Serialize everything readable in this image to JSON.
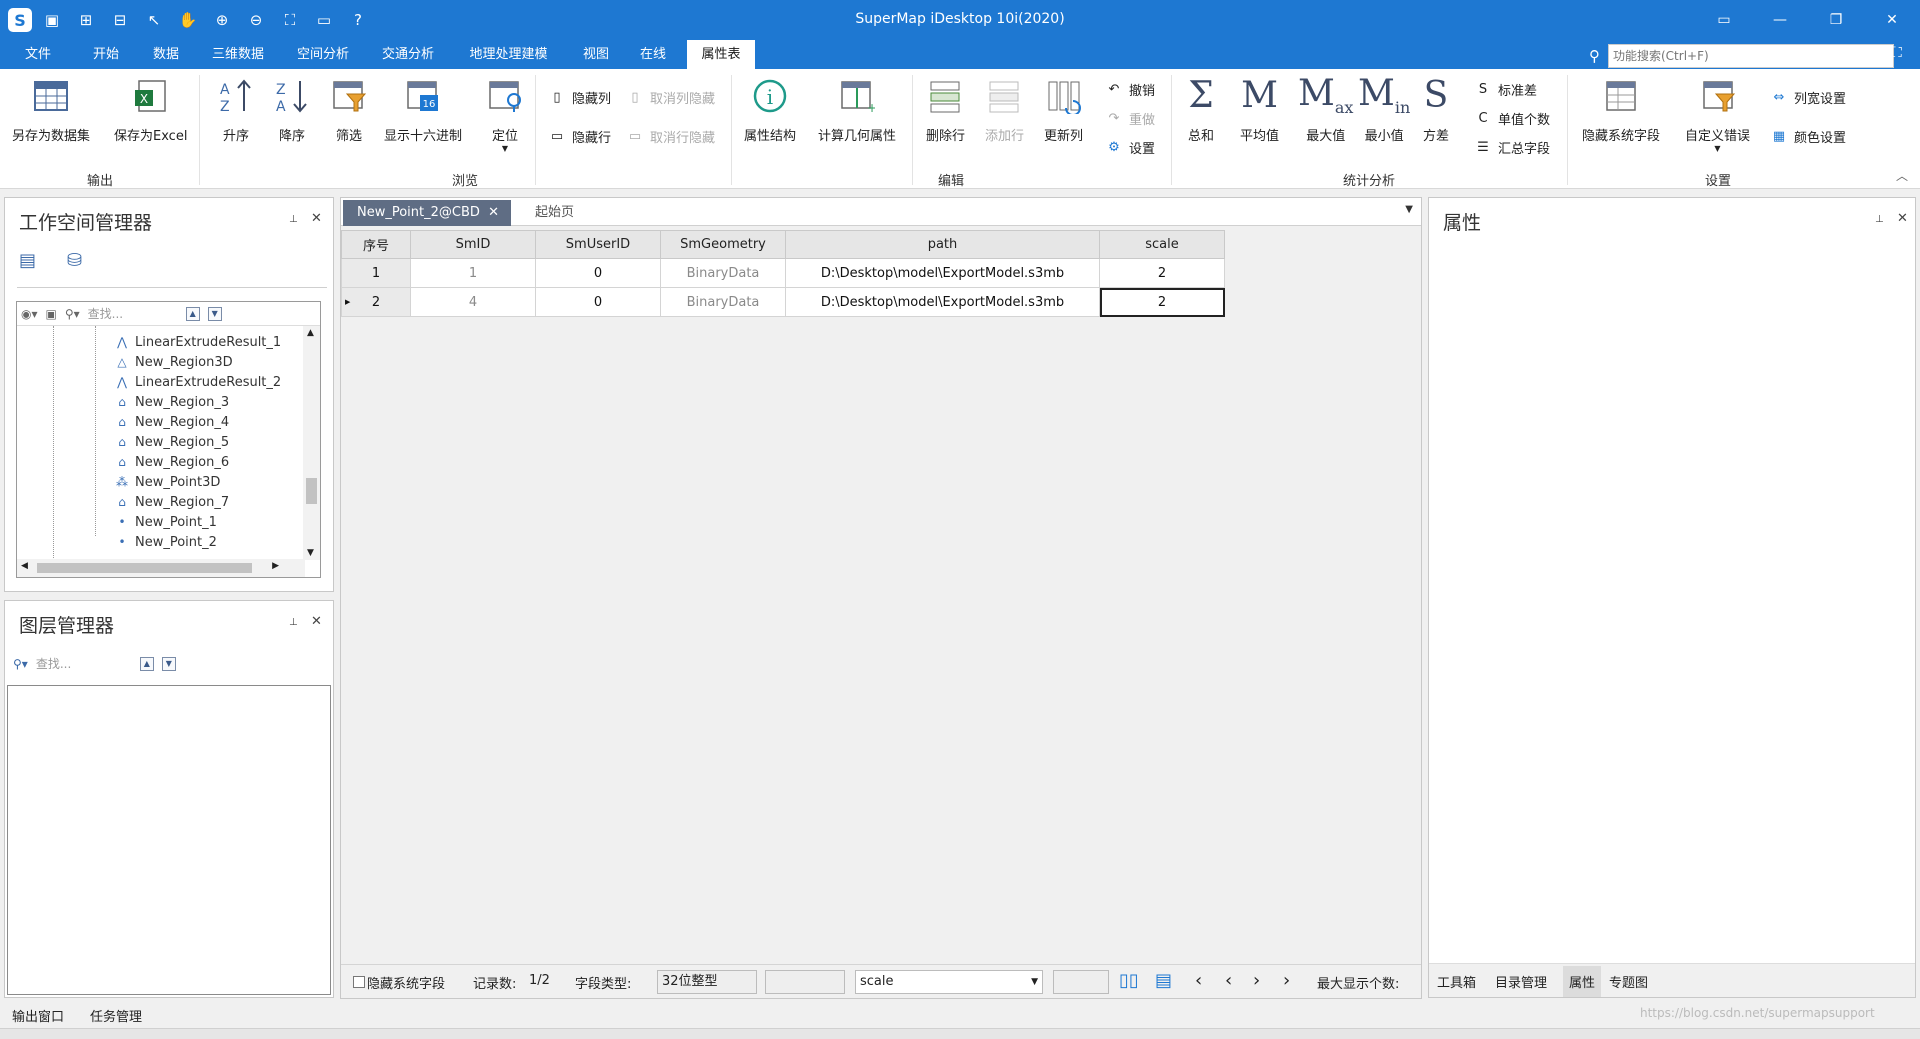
{
  "app": {
    "title": "SuperMap iDesktop 10i(2020)"
  },
  "menu": [
    "文件",
    "开始",
    "数据",
    "三维数据",
    "空间分析",
    "交通分析",
    "地理处理建模",
    "视图",
    "在线",
    "属性表"
  ],
  "active_menu": "属性表",
  "search": {
    "placeholder": "功能搜索(Ctrl+F)"
  },
  "ribbon": {
    "output": {
      "group": "输出",
      "save_dataset": "另存为数据集",
      "save_excel": "保存为Excel"
    },
    "browse": {
      "group": "浏览",
      "asc": "升序",
      "desc": "降序",
      "filter": "筛选",
      "hex": "显示十六进制",
      "locate": "定位",
      "hide_col": "隐藏列",
      "hide_row": "隐藏行",
      "unhide_col": "取消列隐藏",
      "unhide_row": "取消行隐藏"
    },
    "edit": {
      "group": "编辑",
      "attr_struct": "属性结构",
      "calc_geom": "计算几何属性",
      "del_row": "删除行",
      "add_row": "添加行",
      "update_col": "更新列",
      "undo": "撤销",
      "redo": "重做",
      "settings": "设置"
    },
    "stats": {
      "group": "统计分析",
      "sum": "总和",
      "avg": "平均值",
      "max": "最大值",
      "min": "最小值",
      "var": "方差",
      "std": "标准差",
      "unique": "单值个数",
      "summary": "汇总字段"
    },
    "config": {
      "group": "设置",
      "hide_sys": "隐藏系统字段",
      "custom_err": "自定义错误",
      "col_width": "列宽设置",
      "color": "颜色设置"
    }
  },
  "workspace": {
    "title": "工作空间管理器",
    "search_placeholder": "查找...",
    "items": [
      {
        "label": "LinearExtrudeResult_1",
        "icon": "line-dataset-icon"
      },
      {
        "label": "New_Region3D",
        "icon": "region3d-icon"
      },
      {
        "label": "LinearExtrudeResult_2",
        "icon": "line-dataset-icon"
      },
      {
        "label": "New_Region_3",
        "icon": "region-icon"
      },
      {
        "label": "New_Region_4",
        "icon": "region-icon"
      },
      {
        "label": "New_Region_5",
        "icon": "region-icon"
      },
      {
        "label": "New_Region_6",
        "icon": "region-icon"
      },
      {
        "label": "New_Point3D",
        "icon": "point3d-icon"
      },
      {
        "label": "New_Region_7",
        "icon": "region-icon"
      },
      {
        "label": "New_Point_1",
        "icon": "point-icon"
      },
      {
        "label": "New_Point_2",
        "icon": "point-icon"
      }
    ]
  },
  "layers": {
    "title": "图层管理器",
    "search_placeholder": "查找..."
  },
  "properties": {
    "title": "属性",
    "tabs": [
      "工具箱",
      "目录管理",
      "属性",
      "专题图"
    ],
    "active_tab": "属性"
  },
  "document": {
    "tabs": [
      "New_Point_2@CBD",
      "起始页"
    ],
    "columns": [
      "序号",
      "SmID",
      "SmUserID",
      "SmGeometry",
      "path",
      "scale"
    ],
    "rows": [
      [
        "1",
        "1",
        "0",
        "BinaryData",
        "D:\\Desktop\\model\\ExportModel.s3mb",
        "2"
      ],
      [
        "2",
        "4",
        "0",
        "BinaryData",
        "D:\\Desktop\\model\\ExportModel.s3mb",
        "2"
      ]
    ],
    "status": {
      "hide_sys": "隐藏系统字段",
      "records_label": "记录数:",
      "records": "1/2",
      "field_type_label": "字段类型:",
      "field_type": "32位整型",
      "field_name": "scale",
      "max_show_label": "最大显示个数:"
    }
  },
  "bottom": {
    "output_window": "输出窗口",
    "task_manager": "任务管理"
  },
  "watermark": "https://blog.csdn.net/supermapsupport",
  "colors": {
    "accent": "#1e78d2",
    "active_doc_tab": "#5f6d84"
  }
}
